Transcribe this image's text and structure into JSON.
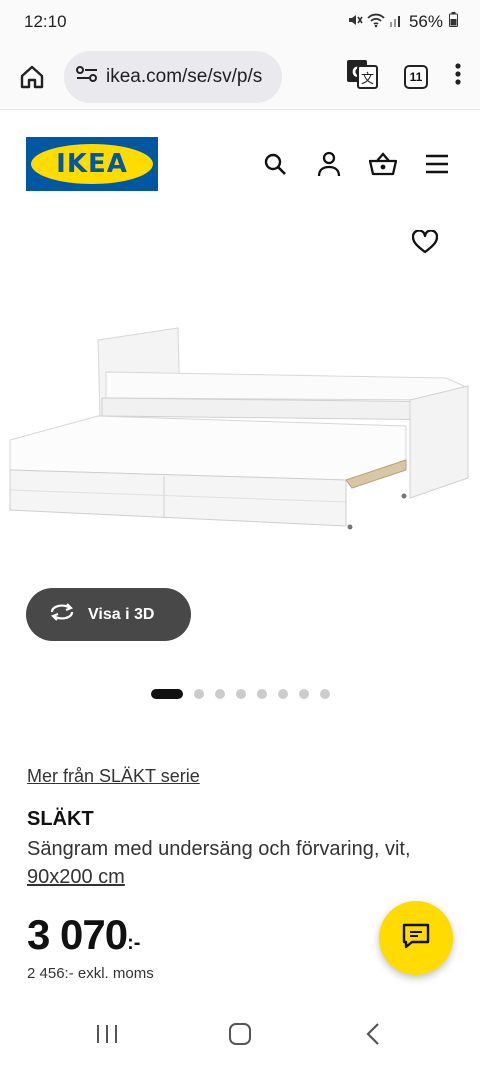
{
  "status_bar": {
    "time": "12:10",
    "battery": "56%",
    "icons": [
      "mute-icon",
      "wifi-icon",
      "signal-icon",
      "battery-icon"
    ]
  },
  "browser": {
    "url": "ikea.com/se/sv/p/s",
    "tab_count": "11",
    "icons": [
      "home-icon",
      "site-settings-icon",
      "translate-icon",
      "tab-switcher-icon",
      "more-menu-icon"
    ]
  },
  "header": {
    "logo_text": "IKEA",
    "icons": [
      "search-icon",
      "account-icon",
      "cart-icon",
      "hamburger-menu-icon"
    ],
    "colors": {
      "logo_blue": "#0058a3",
      "logo_yellow": "#ffdb00"
    }
  },
  "gallery": {
    "view_3d_label": "Visa i 3D",
    "dot_count": 8,
    "active_dot": 1
  },
  "product": {
    "series_link": "Mer från SLÄKT serie",
    "name": "SLÄKT",
    "description": "Sängram med undersäng och förvaring, vit,",
    "size_link": "90x200 cm",
    "price_main": "3 070",
    "price_suffix": ":-",
    "price_excl_vat": "2 456:- exkl. moms"
  },
  "chat": {
    "icon": "chat-icon",
    "color": "#ffdb00"
  },
  "nav_bar": {
    "icons": [
      "recent-apps-icon",
      "home-nav-icon",
      "back-icon"
    ]
  }
}
